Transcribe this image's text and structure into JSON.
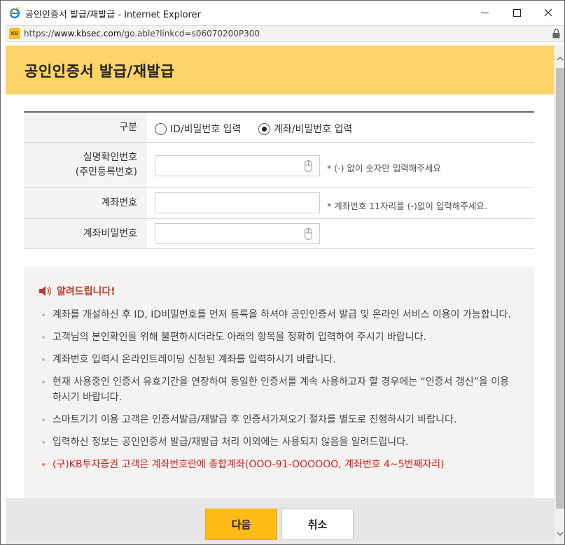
{
  "window": {
    "title": "공인인증서 발급/재발급 - Internet Explorer",
    "icons": {
      "app": "ie-icon",
      "minimize": "minimize-icon",
      "maximize": "maximize-icon",
      "close": "close-icon"
    }
  },
  "address_bar": {
    "scheme": "https://",
    "host": "www.kbsec.com",
    "path": "/go.able?linkcd=s06070200P300",
    "favicon_text": "KB",
    "icons": {
      "site": "kb-favicon-icon",
      "lock": "lock-icon"
    }
  },
  "page": {
    "title": "공인인증서 발급/재발급",
    "header_color": "#fdd468"
  },
  "form": {
    "type_label": "구분",
    "options": [
      {
        "label": "ID/비밀번호 입력",
        "checked": false
      },
      {
        "label": "계좌/비밀번호 입력",
        "checked": true
      }
    ],
    "id_number_label_line1": "실명확인번호",
    "id_number_label_line2": "(주민등록번호)",
    "id_number_value": "",
    "id_number_hint": "* (-) 없이 숫자만 입력해주세요",
    "account_label": "계좌번호",
    "account_value": "",
    "account_hint": "* 계좌번호 11자리를 (-)없이 입력해주세요.",
    "password_label": "계좌비밀번호",
    "password_value": "",
    "icons": {
      "secure_keypad": "mouse-icon"
    }
  },
  "notice": {
    "heading": "알려드립니다!",
    "icon": "speaker-icon",
    "items": [
      "계좌를 개설하신 후 ID, ID비밀번호를 먼저 등록을 하셔야 공인인증서 발급 및 온라인 서비스 이용이 가능합니다.",
      "고객님의 본인확인을 위해 불편하시더라도 아래의 항목을 정확히 입력하여 주시기 바랍니다.",
      "계좌번호 입력시 온라인트레이딩 신청된 계좌를 입력하시기 바랍니다.",
      "현재 사용중인 인증서 유효기간을 연장하여 동일한 인증서를 계속 사용하고자 할 경우에는 “인증서 갱신”을 이용 하시기 바랍니다.",
      "스마트기기 이용 고객은 인증서발급/재발급 후 인증서가져오기 절차를 별도로 진행하시기 바랍니다.",
      "입력하신 정보는 공인인증서 발급/재발급 처리 이외에는 사용되지 않음을 알려드립니다."
    ],
    "red_item": "(구)KB투자증권 고객은 계좌번호란에 종합계좌(OOO-91-OOOOOO, 계좌번호 4~5번째자리)"
  },
  "buttons": {
    "next": "다음",
    "cancel": "취소",
    "accent_color": "#ffbc16"
  }
}
